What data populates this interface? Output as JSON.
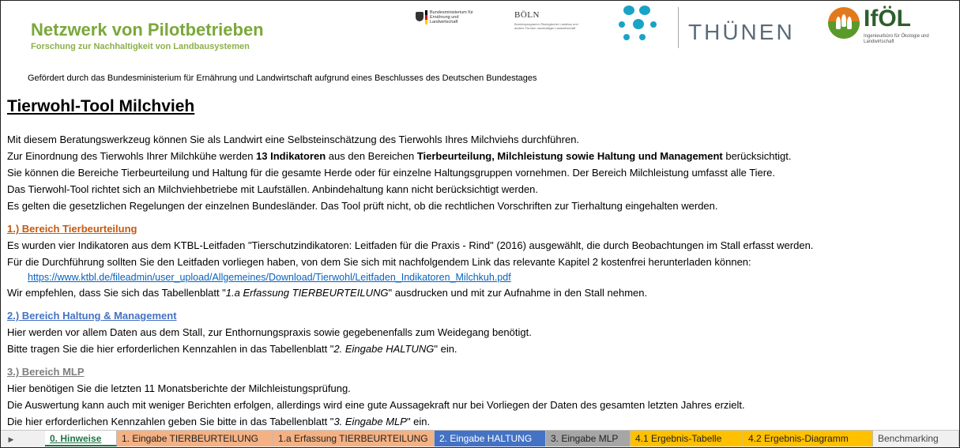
{
  "header": {
    "title": "Netzwerk von Pilotbetrieben",
    "subtitle": "Forschung zur Nachhaltigkeit von Landbausystemen",
    "logos": {
      "bmel_text": "Bundesministerium für Ernährung und Landwirtschaft",
      "boln_title": "BÖLN",
      "boln_sub": "Bundesprogramm Ökologischer Landbau und andere Formen nachhaltiger Landwirtschaft",
      "thuenen": "THÜNEN",
      "ifoel": "IfÖL",
      "ifoel_sub": "Ingenieurbüro für Ökologie und Landwirtschaft"
    },
    "funding": "Gefördert durch das Bundesministerium für Ernährung und Landwirtschaft aufgrund eines Beschlusses des Deutschen Bundestages"
  },
  "main": {
    "title": "Tierwohl-Tool Milchvieh",
    "intro": {
      "l1": "Mit diesem Beratungswerkzeug können Sie als Landwirt eine Selbsteinschätzung des Tierwohls Ihres Milchviehs durchführen.",
      "l2a": "Zur Einordnung des Tierwohls Ihrer Milchkühe werden ",
      "l2b": "13 Indikatoren",
      "l2c": " aus den Bereichen ",
      "l2d": "Tierbeurteilung, Milchleistung sowie Haltung und Management",
      "l2e": " berücksichtigt.",
      "l3": "Sie können die Bereiche Tierbeurteilung und Haltung für die gesamte Herde oder für einzelne Haltungsgruppen vornehmen. Der Bereich Milchleistung umfasst alle Tiere.",
      "l4": "Das Tierwohl-Tool richtet sich an Milchviehbetriebe mit Laufställen. Anbindehaltung kann nicht berücksichtigt werden.",
      "l5": "Es gelten die gesetzlichen Regelungen der einzelnen Bundesländer. Das Tool prüft nicht, ob die rechtlichen Vorschriften zur Tierhaltung eingehalten werden."
    },
    "s1": {
      "heading": "1.) Bereich Tierbeurteilung",
      "l1": "Es wurden vier Indikatoren aus dem KTBL-Leitfaden \"Tierschutzindikatoren: Leitfaden für die Praxis - Rind\" (2016) ausgewählt, die durch Beobachtungen im Stall erfasst werden.",
      "l2": "Für die Durchführung sollten Sie den Leitfaden vorliegen haben, von dem Sie sich mit nachfolgendem Link das relevante Kapitel 2 kostenfrei herunterladen können:",
      "link": "https://www.ktbl.de/fileadmin/user_upload/Allgemeines/Download/Tierwohl/Leitfaden_Indikatoren_Milchkuh.pdf",
      "l3a": "Wir empfehlen, dass Sie sich das Tabellenblatt \"",
      "l3b": "1.a Erfassung TIERBEURTEILUNG",
      "l3c": "\" ausdrucken und mit zur Aufnahme in den Stall nehmen."
    },
    "s2": {
      "heading": "2.) Bereich Haltung & Management",
      "l1": "Hier werden vor allem Daten aus dem Stall, zur Enthornungspraxis sowie gegebenenfalls zum Weidegang benötigt.",
      "l2a": "Bitte tragen Sie die hier erforderlichen Kennzahlen in das Tabellenblatt \"",
      "l2b": "2. Eingabe HALTUNG",
      "l2c": "\" ein."
    },
    "s3": {
      "heading": "3.) Bereich MLP",
      "l1": "Hier benötigen Sie die letzten 11 Monatsberichte der Milchleistungsprüfung.",
      "l2": "Die Auswertung kann auch mit weniger Berichten erfolgen, allerdings wird eine gute Aussagekraft nur bei Vorliegen der Daten des gesamten letzten Jahres erzielt.",
      "l3a": "Die hier erforderlichen Kennzahlen geben Sie bitte in das Tabellenblatt \"",
      "l3b": "3. Eingabe MLP",
      "l3c": "\" ein."
    }
  },
  "tabs": [
    {
      "label": "0. Hinweise",
      "color": "#ffffff",
      "text": "#217346"
    },
    {
      "label": "1. Eingabe TIERBEURTEILUNG",
      "color": "#f4b183",
      "text": "#222222"
    },
    {
      "label": "1.a Erfassung TIERBEURTEILUNG",
      "color": "#f4b183",
      "text": "#222222"
    },
    {
      "label": "2. Eingabe HALTUNG",
      "color": "#4472c4",
      "text": "#ffffff"
    },
    {
      "label": "3. Eingabe MLP",
      "color": "#a6a6a6",
      "text": "#222222"
    },
    {
      "label": "4.1 Ergebnis-Tabelle",
      "color": "#ffc000",
      "text": "#222222"
    },
    {
      "label": "4.2 Ergebnis-Diagramm",
      "color": "#ffc000",
      "text": "#222222"
    },
    {
      "label": "Benchmarking",
      "color": "#f0f0f0",
      "text": "#444444"
    }
  ],
  "nav_icon": "scroll-right-icon"
}
